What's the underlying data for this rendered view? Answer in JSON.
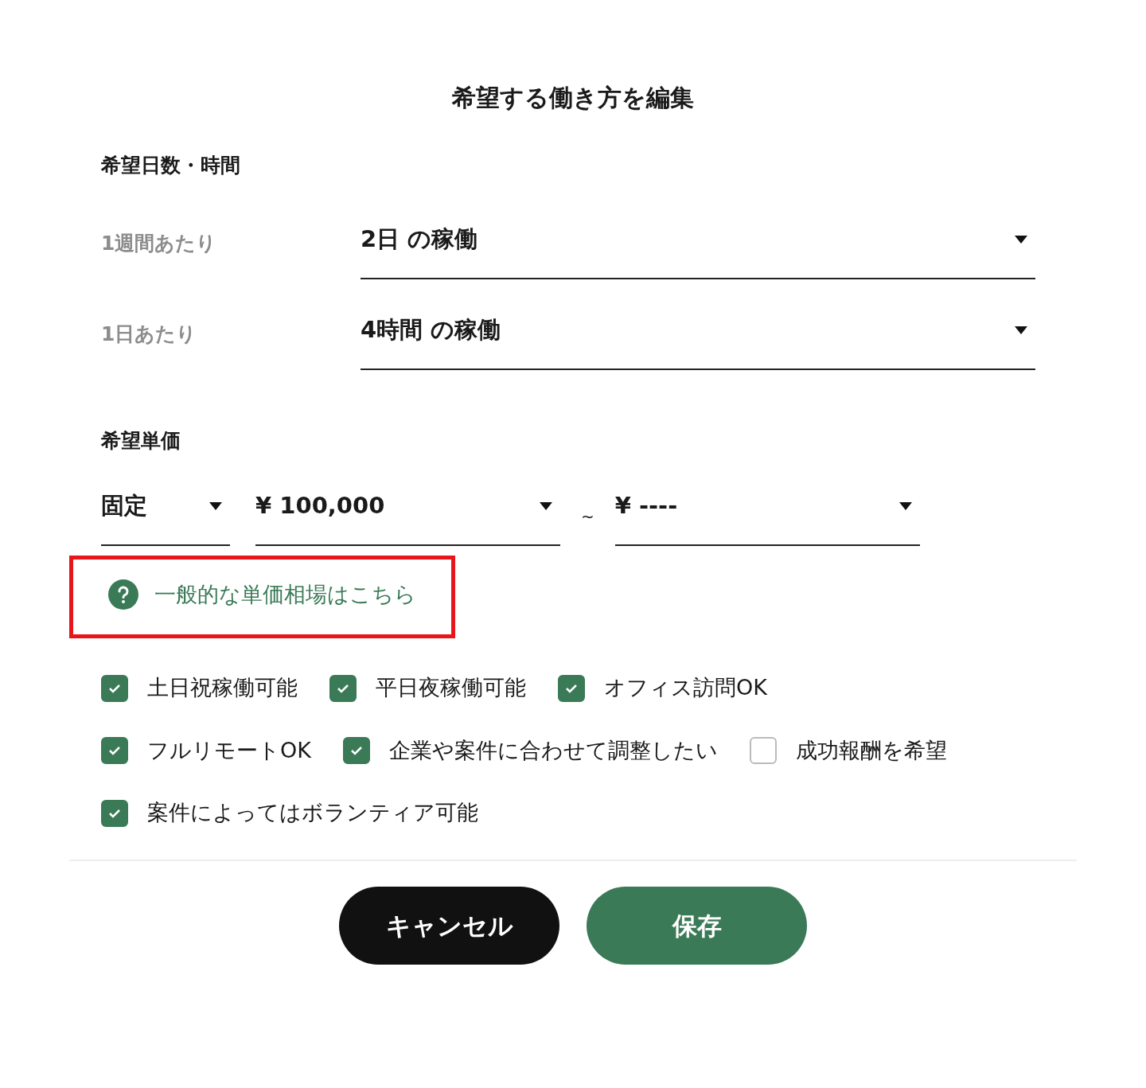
{
  "title": "希望する働き方を編集",
  "schedule": {
    "label": "希望日数・時間",
    "rows": [
      {
        "label": "1週間あたり",
        "value": "2日 の稼働"
      },
      {
        "label": "1日あたり",
        "value": "4時間 の稼働"
      }
    ]
  },
  "price": {
    "label": "希望単価",
    "mode": "固定",
    "min": "¥ 100,000",
    "separator": "~",
    "max": "¥ ----"
  },
  "help_link": {
    "text": "一般的な単価相場はこちら",
    "highlighted": true
  },
  "option_rows": [
    [
      {
        "label": "土日祝稼働可能",
        "checked": true
      },
      {
        "label": "平日夜稼働可能",
        "checked": true
      },
      {
        "label": "オフィス訪問OK",
        "checked": true
      }
    ],
    [
      {
        "label": "フルリモートOK",
        "checked": true
      },
      {
        "label": "企業や案件に合わせて調整したい",
        "checked": true
      },
      {
        "label": "成功報酬を希望",
        "checked": false
      }
    ],
    [
      {
        "label": "案件によってはボランティア可能",
        "checked": true
      }
    ]
  ],
  "buttons": [
    {
      "label": "キャンセル",
      "kind": "secondary"
    },
    {
      "label": "保存",
      "kind": "primary"
    }
  ]
}
